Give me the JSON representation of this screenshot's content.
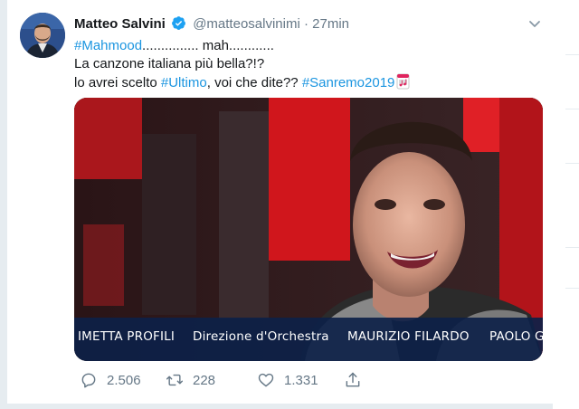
{
  "tweet": {
    "author_name": "Matteo Salvini",
    "handle": "@matteosalvinimi",
    "separator": "·",
    "time": "27min",
    "lines": {
      "line1_tag": "#Mahmood",
      "line1_rest": "............... mah............",
      "line2": "La canzone italiana più bella?!?",
      "line3_pre": "lo avrei scelto ",
      "line3_tag1": "#Ultimo",
      "line3_mid": ", voi che dite?? ",
      "line3_tag2": "#Sanremo2019"
    },
    "media": {
      "caption_segments": [
        "IMETTA PROFILI",
        "Direzione d'Orchestra",
        "MAURIZIO FILARDO",
        "PAOLO G"
      ]
    },
    "actions": {
      "replies": "2.506",
      "retweets": "228",
      "likes": "1.331"
    }
  },
  "colors": {
    "accent": "#1b95e0",
    "muted": "#657786",
    "text": "#14171a",
    "verified": "#1da1f2"
  },
  "icons": [
    "verified-icon",
    "chevron-down-icon",
    "music-emoji-icon",
    "reply-icon",
    "retweet-icon",
    "like-icon",
    "share-icon"
  ]
}
